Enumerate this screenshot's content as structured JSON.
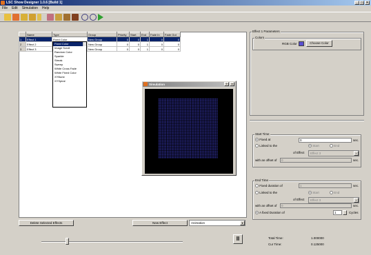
{
  "window": {
    "title": "LSC Show Designer 1.0.6 [Build 1]",
    "min": "_",
    "max": "□",
    "close": "×"
  },
  "menu": [
    "File",
    "Edit",
    "Simulation",
    "Help"
  ],
  "grid": {
    "headers": [
      "Name",
      "Type",
      "Group",
      "Priority",
      "Start",
      "End",
      "Fade In",
      "Fade Out"
    ],
    "rows": [
      {
        "num": "1",
        "name": "Effect 1",
        "type": "Fixed Color",
        "group": "New Group",
        "priority": "0",
        "start": "0",
        "end": "1",
        "fade_in": "0",
        "fade_out": "0"
      },
      {
        "num": "2",
        "name": "Effect 2",
        "type": "Fixed Color",
        "group": "New Group",
        "priority": "0",
        "start": "0",
        "end": "1",
        "fade_in": "0",
        "fade_out": "0"
      },
      {
        "num": "3",
        "name": "Effect 3",
        "type": "Image Scroll",
        "group": "New Group",
        "priority": "0",
        "start": "0",
        "end": "1",
        "fade_in": "0",
        "fade_out": "0"
      }
    ]
  },
  "type_dropdown": [
    "Fixed Color",
    "Image Scroll",
    "Random Color",
    "Sparkle",
    "Streak",
    "Sweep",
    "White Cross Fade",
    "White Fixed Color",
    "XYBurst",
    "XYSpiral"
  ],
  "buttons": {
    "delete": "Delete Selected Effects",
    "new_effect": "New Effect",
    "choose_color": "Choose Color"
  },
  "animation_combo": "Animation",
  "simulation": {
    "title": "Simulation",
    "help": "?",
    "close": "×",
    "led_color": "#3b3bbf"
  },
  "params": {
    "group_title": "Effect 1 Parameters",
    "colors_title": "Colors",
    "rgb_label": "RGB Color",
    "rgb_value": "#5a4fd0"
  },
  "start_time": {
    "title": "Start Time",
    "fixed_label": "Fixed at",
    "fixed_value": "0",
    "sec": "sec.",
    "linked_label": "Linked to the",
    "start_opt": "Start",
    "end_opt": "End",
    "of_effect": "of Effect",
    "effect_value": "Effect 3",
    "offset_label": "with an offset of",
    "offset_value": "0"
  },
  "end_time": {
    "title": "End Time",
    "fixed_dur_label": "Fixed duration of",
    "fixed_dur_value": "1",
    "sec": "sec.",
    "linked_label": "Linked to the",
    "start_opt": "Start",
    "end_opt": "End",
    "of_effect": "of Effect",
    "effect_value": "Effect 3",
    "offset_label": "with an offset of",
    "offset_value": "0",
    "fixed_anim_label": "A fixed Duration of",
    "cycles_value": "1",
    "cycles_label": "Cycles"
  },
  "status": {
    "total_label": "Total Time:",
    "total_value": "1.000000",
    "cur_label": "Cur Time:",
    "cur_value": "0.125000"
  },
  "playback": {
    "pause": "II",
    "slider_position": 0.18
  }
}
